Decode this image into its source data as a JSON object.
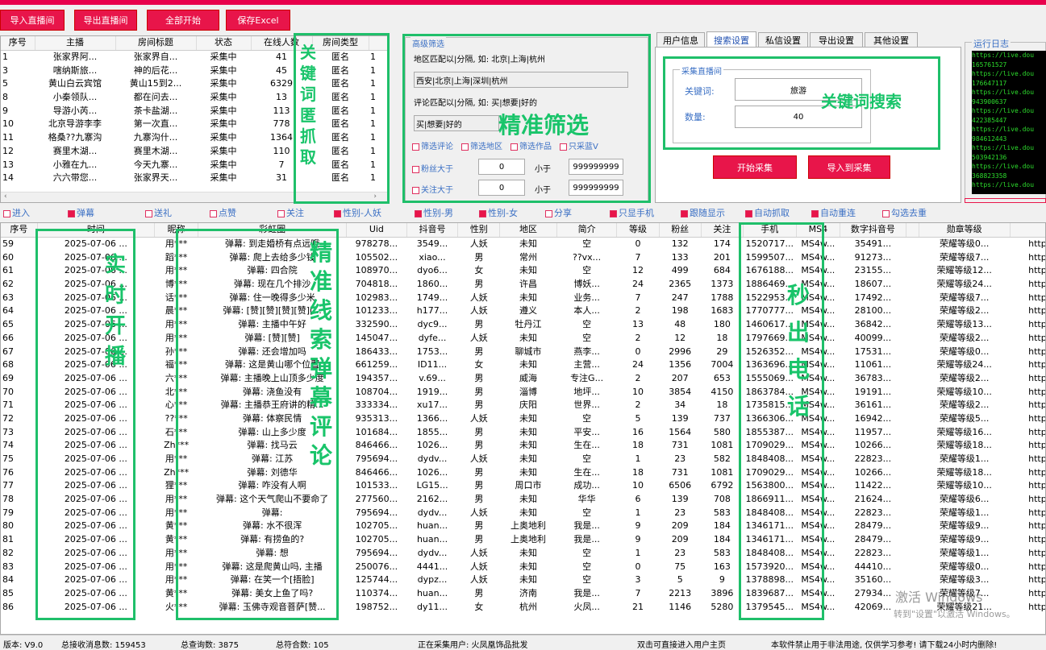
{
  "toolbar": {
    "import_live": "导入直播间",
    "export_live": "导出直播间",
    "start_all": "全部开始",
    "save_excel": "保存Excel"
  },
  "rooms": {
    "headers": [
      "序号",
      "主播",
      "房间标题",
      "状态",
      "在线人数",
      "房间类型"
    ],
    "rows": [
      [
        "1",
        "张家界阿...",
        "张家界自...",
        "采集中",
        "41",
        "匿名",
        "1"
      ],
      [
        "3",
        "嗐纳斯旅...",
        "神的后花...",
        "采集中",
        "45",
        "匿名",
        "1"
      ],
      [
        "5",
        "黄山白云宾馆",
        "黄山15到2...",
        "采集中",
        "6329",
        "匿名",
        "1"
      ],
      [
        "8",
        "小秦领队...",
        "都在问去...",
        "采集中",
        "13",
        "匿名",
        "1"
      ],
      [
        "9",
        "导游小芮...",
        "茶卡盐湖...",
        "采集中",
        "113",
        "匿名",
        "1"
      ],
      [
        "10",
        "北京导游李李",
        "第一次直...",
        "采集中",
        "778",
        "匿名",
        "1"
      ],
      [
        "11",
        "格桑??九寨沟",
        "九寨沟什...",
        "采集中",
        "1364",
        "匿名",
        "1"
      ],
      [
        "12",
        "赛里木湖...",
        "赛里木湖...",
        "采集中",
        "110",
        "匿名",
        "1"
      ],
      [
        "13",
        "小雅在九...",
        "今天九寨...",
        "采集中",
        "7",
        "匿名",
        "1"
      ],
      [
        "14",
        "六六带您...",
        "张家界天...",
        "采集中",
        "31",
        "匿名",
        "1"
      ]
    ]
  },
  "filter": {
    "title": "高级筛选",
    "region_hint": "地区匹配以|分隔, 如: 北京|上海|杭州",
    "region_value": "西安|北京|上海|深圳|杭州",
    "comment_hint": "评论匹配以|分隔, 如: 买|想要|好的",
    "comment_value": "买|想要|好的",
    "cb_comment": "筛选评论",
    "cb_region": "筛选地区",
    "cb_works": "筛选作品",
    "cb_bluev": "只采蓝V",
    "fans_gt": "粉丝大于",
    "follow_gt": "关注大于",
    "lt": "小于",
    "fans_min": "0",
    "fans_max": "999999999",
    "follow_min": "0",
    "follow_max": "999999999"
  },
  "tabs": [
    "用户信息",
    "搜索设置",
    "私信设置",
    "导出设置",
    "其他设置"
  ],
  "search": {
    "group_title": "采集直播间",
    "keyword_label": "关键词:",
    "keyword_value": "旅游",
    "count_label": "数量:",
    "count_value": "40",
    "start_button": "开始采集",
    "import_button": "导入到采集"
  },
  "log": {
    "title": "运行日志",
    "lines": [
      "https://live.dou",
      "165761527",
      "https://live.dou",
      "176647117",
      "https://live.dou",
      "943900637",
      "https://live.dou",
      "422385447",
      "https://live.dou",
      "984612443",
      "https://live.dou",
      "503942136",
      "https://live.dou",
      "368823358",
      "https://live.dou"
    ]
  },
  "checks": [
    {
      "label": "进入",
      "on": false
    },
    {
      "label": "弹幕",
      "on": true
    },
    {
      "label": "送礼",
      "on": false
    },
    {
      "label": "点赞",
      "on": false
    },
    {
      "label": "关注",
      "on": false
    },
    {
      "label": "性别-人妖",
      "on": true
    },
    {
      "label": "性别-男",
      "on": true
    },
    {
      "label": "性别-女",
      "on": true
    },
    {
      "label": "分享",
      "on": false
    },
    {
      "label": "只显手机",
      "on": true
    },
    {
      "label": "跟随显示",
      "on": true
    },
    {
      "label": "自动抓取",
      "on": true
    },
    {
      "label": "自动重连",
      "on": true
    },
    {
      "label": "勾选去重",
      "on": false
    }
  ],
  "main": {
    "headers": [
      "序号",
      "时间",
      "昵称",
      "彩虹圈",
      "Uid",
      "抖音号",
      "性别",
      "地区",
      "简介",
      "等级",
      "粉丝",
      "关注",
      "手机",
      "MS4",
      "数字抖音号",
      "",
      "勋章等级",
      ""
    ],
    "rows": [
      [
        "59",
        "2025-07-06 ...",
        "用***",
        "弹幕: 到走婚桥有点远哦",
        "978278...",
        "3549...",
        "人妖",
        "未知",
        "空",
        "0",
        "132",
        "174",
        "1520717...",
        "MS4w...",
        "35491...",
        "荣耀等级0...",
        "http"
      ],
      [
        "60",
        "2025-07-06 ...",
        "蹈***",
        "弹幕: 爬上去给多少钱",
        "105502...",
        "xiao...",
        "男",
        "常州",
        "??vx...",
        "7",
        "133",
        "201",
        "1599507...",
        "MS4w...",
        "91273...",
        "荣耀等级7...",
        "http"
      ],
      [
        "61",
        "2025-07-06 ...",
        "用***",
        "弹幕: 四合院",
        "108970...",
        "dyo6...",
        "女",
        "未知",
        "空",
        "12",
        "499",
        "684",
        "1676188...",
        "MS4w...",
        "23155...",
        "荣耀等级12...",
        "http"
      ],
      [
        "62",
        "2025-07-06 ...",
        "博***",
        "弹幕: 现在几个排沙",
        "704818...",
        "1860...",
        "男",
        "许昌",
        "博妖...",
        "24",
        "2365",
        "1373",
        "1886469...",
        "MS4w...",
        "18607...",
        "荣耀等级24...",
        "http"
      ],
      [
        "63",
        "2025-07-06 ...",
        "话***",
        "弹幕: 住一晚得多少米",
        "102983...",
        "1749...",
        "人妖",
        "未知",
        "业务...",
        "7",
        "247",
        "1788",
        "1522953...",
        "MS4w...",
        "17492...",
        "荣耀等级7...",
        "http"
      ],
      [
        "64",
        "2025-07-06 ...",
        "晨***",
        "弹幕: [赞][赞][赞][赞][...",
        "101233...",
        "h177...",
        "人妖",
        "遵义",
        "本人...",
        "2",
        "198",
        "1683",
        "1770777...",
        "MS4w...",
        "28100...",
        "荣耀等级2...",
        "http"
      ],
      [
        "65",
        "2025-07-06 ...",
        "用***",
        "弹幕: 主播中午好",
        "332590...",
        "dyc9...",
        "男",
        "牡丹江",
        "空",
        "13",
        "48",
        "180",
        "1460617...",
        "MS4w...",
        "36842...",
        "荣耀等级13...",
        "http"
      ],
      [
        "66",
        "2025-07-06 ...",
        "用***",
        "弹幕: [赞][赞]",
        "145047...",
        "dyfe...",
        "人妖",
        "未知",
        "空",
        "2",
        "12",
        "18",
        "1797669...",
        "MS4w...",
        "40099...",
        "荣耀等级2...",
        "http"
      ],
      [
        "67",
        "2025-07-06 ...",
        "孙***",
        "弹幕: 还会增加吗",
        "186433...",
        "1753...",
        "男",
        "聊城市",
        "燕李...",
        "0",
        "2996",
        "29",
        "1526352...",
        "MS4w...",
        "17531...",
        "荣耀等级0...",
        "http"
      ],
      [
        "68",
        "2025-07-06 ...",
        "福***",
        "弹幕: 这是黄山哪个位置",
        "661259...",
        "ID11...",
        "女",
        "未知",
        "主营...",
        "24",
        "1356",
        "7004",
        "1363696...",
        "MS4w...",
        "11061...",
        "荣耀等级24...",
        "http"
      ],
      [
        "69",
        "2025-07-06 ...",
        "六***",
        "弹幕: 主播晚上山顶多少度",
        "194357...",
        "v.69...",
        "男",
        "威海",
        "专注G...",
        "2",
        "207",
        "653",
        "1555069...",
        "MS4w...",
        "36783...",
        "荣耀等级2...",
        "http"
      ],
      [
        "70",
        "2025-07-06 ...",
        "北***",
        "弹幕: 浇鱼没有",
        "108704...",
        "1919...",
        "男",
        "淄博",
        "地坪...",
        "10",
        "3854",
        "4150",
        "1863784...",
        "MS4w...",
        "19191...",
        "荣耀等级10...",
        "http"
      ],
      [
        "71",
        "2025-07-06 ...",
        "心***",
        "弹幕: 主播恭王府讲的精...",
        "333334...",
        "xu17...",
        "男",
        "庆阳",
        "世界...",
        "2",
        "34",
        "18",
        "1735815...",
        "MS4w...",
        "36161...",
        "荣耀等级2...",
        "http"
      ],
      [
        "72",
        "2025-07-06 ...",
        "??***",
        "弹幕: 体察民情",
        "935313...",
        "1366...",
        "人妖",
        "未知",
        "空",
        "5",
        "139",
        "737",
        "1366306...",
        "MS4w...",
        "16942...",
        "荣耀等级5...",
        "http"
      ],
      [
        "73",
        "2025-07-06 ...",
        "石***",
        "弹幕: 山上多少度",
        "101684...",
        "1855...",
        "男",
        "未知",
        "平安...",
        "16",
        "1564",
        "580",
        "1855387...",
        "MS4w...",
        "11957...",
        "荣耀等级16...",
        "http"
      ],
      [
        "74",
        "2025-07-06 ...",
        "Zh***",
        "弹幕: 找马云",
        "846466...",
        "1026...",
        "男",
        "未知",
        "生在...",
        "18",
        "731",
        "1081",
        "1709029...",
        "MS4w...",
        "10266...",
        "荣耀等级18...",
        "http"
      ],
      [
        "75",
        "2025-07-06 ...",
        "用***",
        "弹幕: 江苏",
        "795694...",
        "dydv...",
        "人妖",
        "未知",
        "空",
        "1",
        "23",
        "582",
        "1848408...",
        "MS4w...",
        "22823...",
        "荣耀等级1...",
        "http"
      ],
      [
        "76",
        "2025-07-06 ...",
        "Zh***",
        "弹幕: 刘德华",
        "846466...",
        "1026...",
        "男",
        "未知",
        "生在...",
        "18",
        "731",
        "1081",
        "1709029...",
        "MS4w...",
        "10266...",
        "荣耀等级18...",
        "http"
      ],
      [
        "77",
        "2025-07-06 ...",
        "狸***",
        "弹幕: 咋没有人啊",
        "101533...",
        "LG15...",
        "男",
        "周口市",
        "成功...",
        "10",
        "6506",
        "6792",
        "1563800...",
        "MS4w...",
        "11422...",
        "荣耀等级10...",
        "http"
      ],
      [
        "78",
        "2025-07-06 ...",
        "用***",
        "弹幕: 这个天气爬山不要命了",
        "277560...",
        "2162...",
        "男",
        "未知",
        "华华",
        "6",
        "139",
        "708",
        "1866911...",
        "MS4w...",
        "21624...",
        "荣耀等级6...",
        "http"
      ],
      [
        "79",
        "2025-07-06 ...",
        "用***",
        "弹幕:",
        "795694...",
        "dydv...",
        "人妖",
        "未知",
        "空",
        "1",
        "23",
        "583",
        "1848408...",
        "MS4w...",
        "22823...",
        "荣耀等级1...",
        "http"
      ],
      [
        "80",
        "2025-07-06 ...",
        "黄***",
        "弹幕: 水不很浑",
        "102705...",
        "huan...",
        "男",
        "上奥地利",
        "我是...",
        "9",
        "209",
        "184",
        "1346171...",
        "MS4w...",
        "28479...",
        "荣耀等级9...",
        "http"
      ],
      [
        "81",
        "2025-07-06 ...",
        "黄***",
        "弹幕: 有捞鱼的?",
        "102705...",
        "huan...",
        "男",
        "上奥地利",
        "我是...",
        "9",
        "209",
        "184",
        "1346171...",
        "MS4w...",
        "28479...",
        "荣耀等级9...",
        "http"
      ],
      [
        "82",
        "2025-07-06 ...",
        "用***",
        "弹幕: 想",
        "795694...",
        "dydv...",
        "人妖",
        "未知",
        "空",
        "1",
        "23",
        "583",
        "1848408...",
        "MS4w...",
        "22823...",
        "荣耀等级1...",
        "http"
      ],
      [
        "83",
        "2025-07-06 ...",
        "用***",
        "弹幕: 这是爬黄山吗, 主播",
        "250076...",
        "4441...",
        "人妖",
        "未知",
        "空",
        "0",
        "75",
        "163",
        "1573920...",
        "MS4w...",
        "44410...",
        "荣耀等级0...",
        "http"
      ],
      [
        "84",
        "2025-07-06 ...",
        "用***",
        "弹幕: 在笑一个[捂脸]",
        "125744...",
        "dypz...",
        "人妖",
        "未知",
        "空",
        "3",
        "5",
        "9",
        "1378898...",
        "MS4w...",
        "35160...",
        "荣耀等级3...",
        "http"
      ],
      [
        "85",
        "2025-07-06 ...",
        "黄***",
        "弹幕: 美女上鱼了吗?",
        "110374...",
        "huan...",
        "男",
        "济南",
        "我是...",
        "7",
        "2213",
        "3896",
        "1839687...",
        "MS4w...",
        "27934...",
        "荣耀等级7...",
        "http"
      ],
      [
        "86",
        "2025-07-06 ...",
        "火***",
        "弹幕: 玉佛寺观音菩萨[赞...",
        "198752...",
        "dy11...",
        "女",
        "杭州",
        "火凤...",
        "21",
        "1146",
        "5280",
        "1379545...",
        "MS4w...",
        "42069...",
        "荣耀等级21...",
        "http"
      ]
    ]
  },
  "statusbar": {
    "version": "版本: V9.0",
    "total_msgs": "总接收消息数: 159453",
    "total_query": "总查询数: 3875",
    "total_match": "总符合数: 105",
    "collecting": "正在采集用户: 火凤凰饰品批发",
    "dblclick": "双击可直接进入用户主页",
    "notice": "本软件禁止用于非法用途, 仅供学习参考! 请下载24小时内删除!"
  },
  "annotations": {
    "room_grab": "关键词匿抓取",
    "precise_filter": "精准筛选",
    "keyword_search": "关键词搜索",
    "realtime": "实时开播",
    "danmu": "精准线索弹幕评论",
    "phone": "秒出电话"
  },
  "watermark": {
    "line1": "激活 Windows",
    "line2": "转到\"设置\"以激活 Windows。"
  }
}
